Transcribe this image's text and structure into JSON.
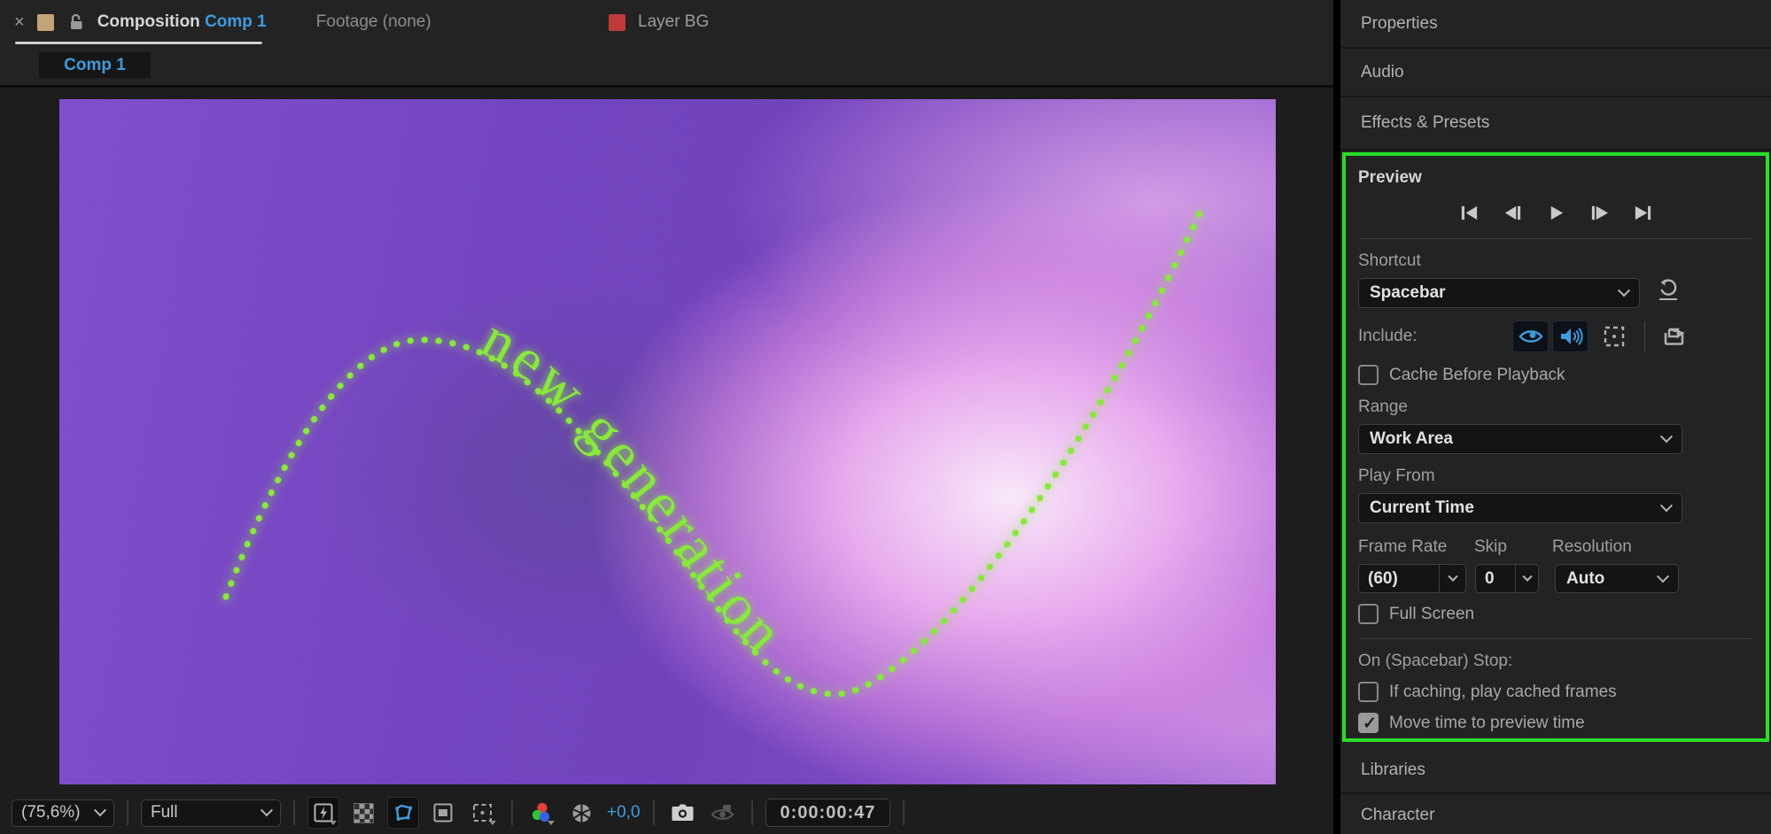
{
  "colors": {
    "accent-blue": "#3f9bdc",
    "highlight-green": "#29dd29",
    "path-green": "#86e83a",
    "swatch-tan": "#c2a478",
    "swatch-red": "#c03a3a"
  },
  "tabs": {
    "close": "×",
    "composition_label": "Composition",
    "composition_name": "Comp 1",
    "footage_label": "Footage (none)",
    "layer_label": "Layer BG",
    "comp_subtab": "Comp 1"
  },
  "canvas": {
    "text_on_path": "new generation"
  },
  "toolbar": {
    "zoom_value": "(75,6%)",
    "resolution_value": "Full",
    "exposure_value": "+0,0",
    "timecode": "0:00:00:47"
  },
  "right_panel": {
    "properties": "Properties",
    "audio": "Audio",
    "effects_presets": "Effects & Presets",
    "libraries": "Libraries",
    "character": "Character"
  },
  "preview": {
    "title": "Preview",
    "shortcut_label": "Shortcut",
    "shortcut_value": "Spacebar",
    "include_label": "Include:",
    "cache_label": "Cache Before Playback",
    "cache_checked": "false",
    "range_label": "Range",
    "range_value": "Work Area",
    "play_from_label": "Play From",
    "play_from_value": "Current Time",
    "frame_rate_label": "Frame Rate",
    "frame_rate_value": "(60)",
    "skip_label": "Skip",
    "skip_value": "0",
    "resolution_label": "Resolution",
    "resolution_value": "Auto",
    "full_screen_label": "Full Screen",
    "full_screen_checked": "false",
    "on_stop_label": "On (Spacebar) Stop:",
    "if_caching_label": "If caching, play cached frames",
    "if_caching_checked": "false",
    "move_time_label": "Move time to preview time",
    "move_time_checked": "true"
  }
}
